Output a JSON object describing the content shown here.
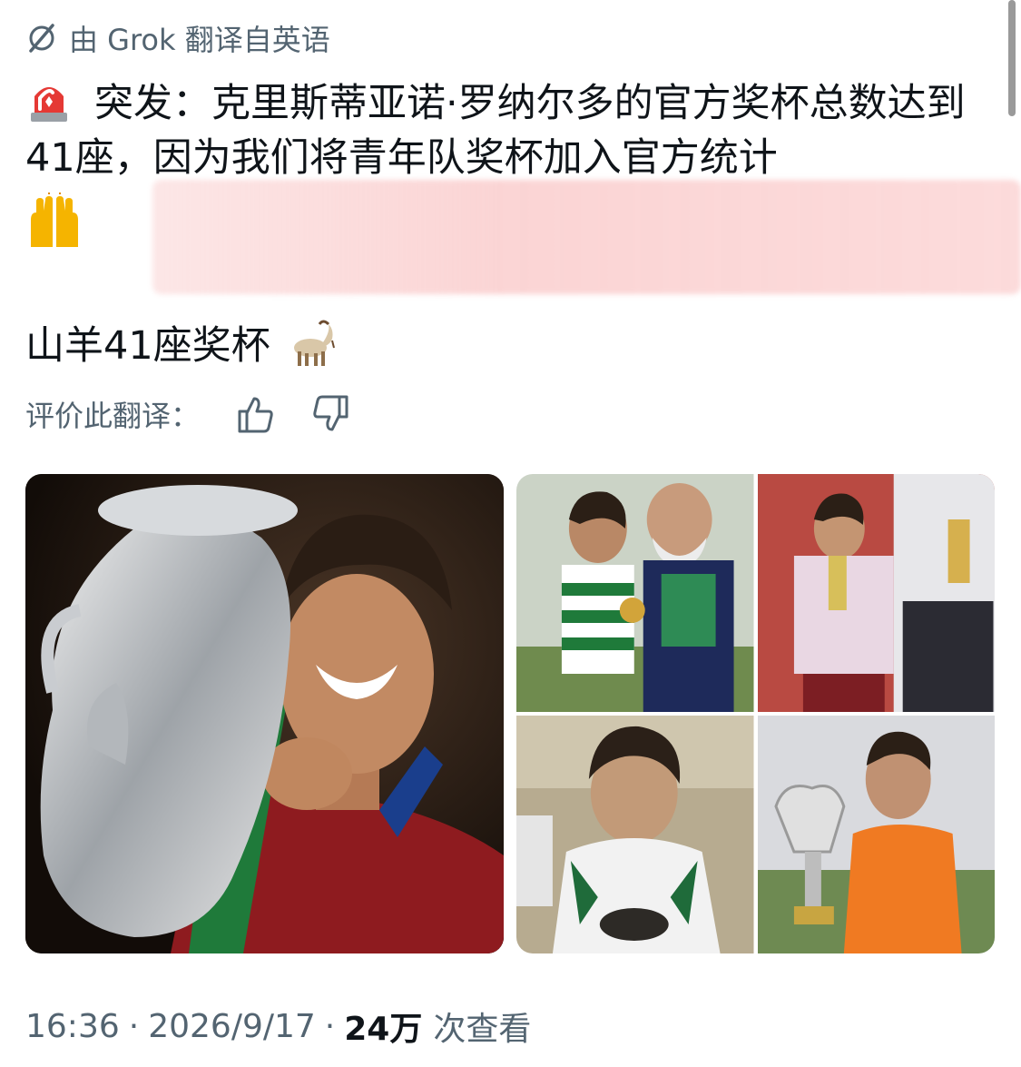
{
  "translation": {
    "label": "由 Grok 翻译自英语",
    "icon": "grok-icon"
  },
  "post": {
    "siren_icon": "siren-emoji",
    "text": "突发：克里斯蒂亚诺·罗纳尔多的官方奖杯总数达到41座，因为我们将青年队奖杯加入官方统计",
    "hands_icon": "raising-hands-emoji",
    "second_line": "山羊41座奖杯",
    "goat_icon": "goat-emoji"
  },
  "rating": {
    "label": "评价此翻译：",
    "thumbs_up_icon": "thumbs-up-icon",
    "thumbs_down_icon": "thumbs-down-icon"
  },
  "media": {
    "image_count": 2,
    "grid_cells": 4
  },
  "meta": {
    "time": "16:36",
    "date": "2026/9/17",
    "separator": "·",
    "views_count": "24万",
    "views_label": "次查看"
  },
  "colors": {
    "text": "#0f1419",
    "secondary": "#536471",
    "redaction": "#f9d2d2"
  }
}
